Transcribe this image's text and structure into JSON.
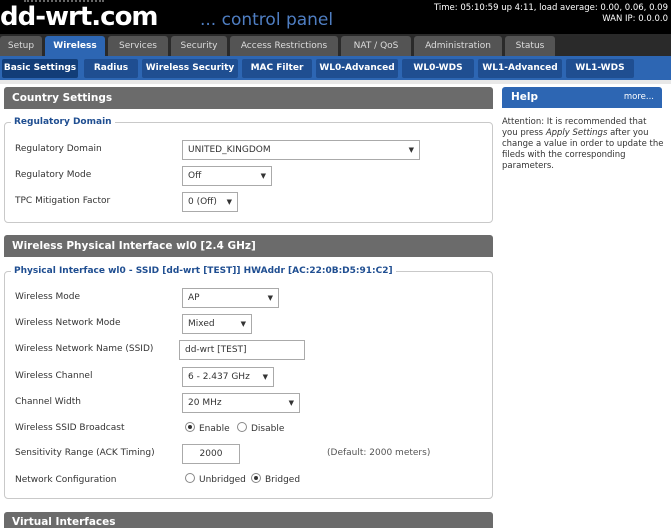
{
  "header": {
    "logo_main": "dd-wrt.com",
    "logo_sub": "... control panel",
    "status_time": "Time: 05:10:59 up 4:11, load average: 0.00, 0.06, 0.09",
    "status_wan": "WAN IP: 0.0.0.0"
  },
  "main_tabs": [
    {
      "label": "Setup"
    },
    {
      "label": "Wireless"
    },
    {
      "label": "Services"
    },
    {
      "label": "Security"
    },
    {
      "label": "Access Restrictions"
    },
    {
      "label": "NAT / QoS"
    },
    {
      "label": "Administration"
    },
    {
      "label": "Status"
    }
  ],
  "sub_tabs": [
    {
      "label": "Basic Settings"
    },
    {
      "label": "Radius"
    },
    {
      "label": "Wireless Security"
    },
    {
      "label": "MAC Filter"
    },
    {
      "label": "WL0-Advanced"
    },
    {
      "label": "WL0-WDS"
    },
    {
      "label": "WL1-Advanced"
    },
    {
      "label": "WL1-WDS"
    }
  ],
  "country": {
    "title": "Country Settings",
    "legend": "Regulatory Domain",
    "regulatory_domain_label": "Regulatory Domain",
    "regulatory_domain_value": "UNITED_KINGDOM",
    "regulatory_mode_label": "Regulatory Mode",
    "regulatory_mode_value": "Off",
    "tpc_label": "TPC Mitigation Factor",
    "tpc_value": "0 (Off)"
  },
  "wl0": {
    "title": "Wireless Physical Interface wl0 [2.4 GHz]",
    "legend": "Physical Interface wl0 - SSID [dd-wrt [TEST]] HWAddr [AC:22:0B:D5:91:C2]",
    "mode_label": "Wireless Mode",
    "mode_value": "AP",
    "net_mode_label": "Wireless Network Mode",
    "net_mode_value": "Mixed",
    "ssid_label": "Wireless Network Name (SSID)",
    "ssid_value": "dd-wrt [TEST]",
    "channel_label": "Wireless Channel",
    "channel_value": "6 - 2.437 GHz",
    "width_label": "Channel Width",
    "width_value": "20 MHz",
    "broadcast_label": "Wireless SSID Broadcast",
    "broadcast_enable": "Enable",
    "broadcast_disable": "Disable",
    "ack_label": "Sensitivity Range (ACK Timing)",
    "ack_value": "2000",
    "ack_default": "(Default: 2000 meters)",
    "netconf_label": "Network Configuration",
    "netconf_unbridged": "Unbridged",
    "netconf_bridged": "Bridged"
  },
  "virtual": {
    "title": "Virtual Interfaces"
  },
  "help": {
    "title": "Help",
    "more": "more...",
    "text_1": "Attention: It is recommended that you press ",
    "text_em": "Apply Settings",
    "text_2": " after you change a value in order to update the fileds with the corresponding parameters."
  }
}
